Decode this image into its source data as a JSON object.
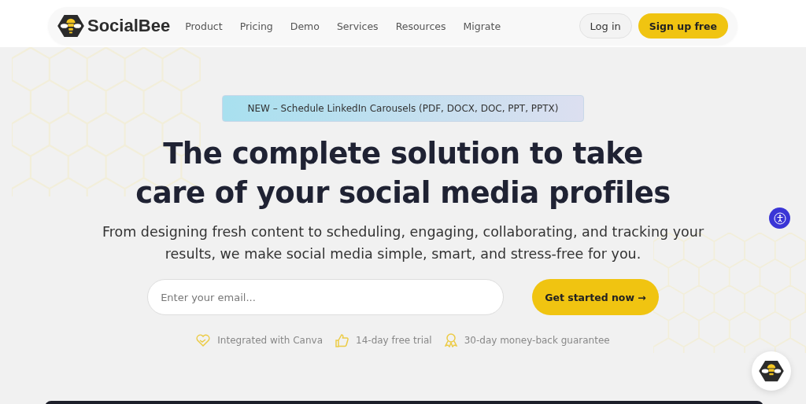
{
  "header": {
    "brand": "SocialBee",
    "nav": [
      {
        "label": "Product"
      },
      {
        "label": "Pricing"
      },
      {
        "label": "Demo"
      },
      {
        "label": "Services"
      },
      {
        "label": "Resources"
      },
      {
        "label": "Migrate"
      }
    ],
    "login": "Log in",
    "signup": "Sign up free"
  },
  "hero": {
    "banner": "NEW – Schedule LinkedIn Carousels (PDF, DOCX, DOC, PPT, PPTX)",
    "headline": [
      "The complete solution to take",
      "care of your social media profiles"
    ],
    "subtitle": "From designing fresh content to scheduling, engaging, collaborating, and tracking your results, we make social media simple, smart, and stress-free for you.",
    "email": {
      "placeholder": "Enter your email..."
    },
    "cta": "Get started now →",
    "features": [
      {
        "kind": "heart",
        "text": "Integrated with Canva"
      },
      {
        "kind": "thumb",
        "text": "14-day free trial"
      },
      {
        "kind": "award",
        "text": "30-day money-back guarantee"
      }
    ]
  }
}
